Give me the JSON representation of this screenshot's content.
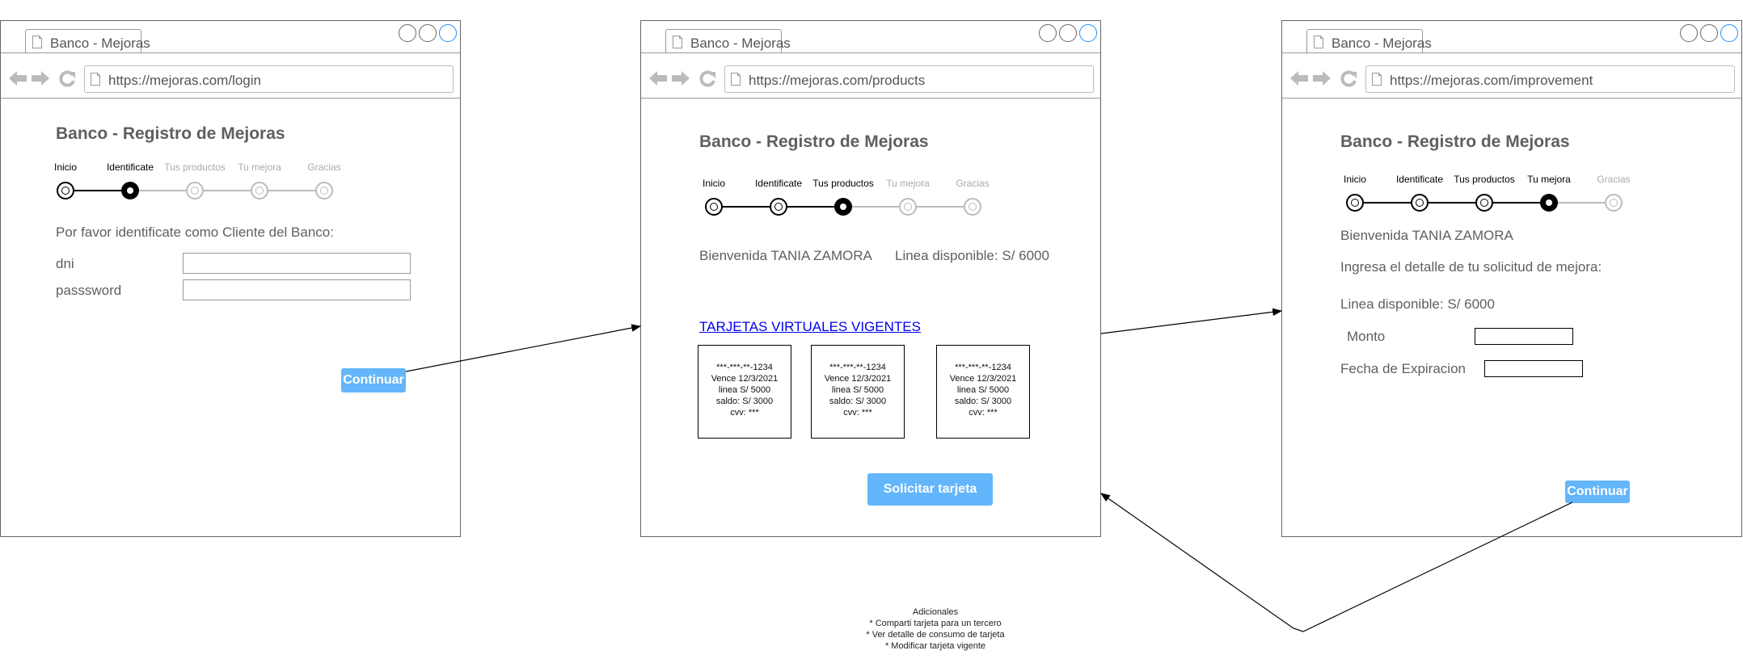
{
  "tab_title": "Banco - Mejoras",
  "heading": "Banco - Registro de Mejoras",
  "steps": [
    "Inicio",
    "Identificate",
    "Tus productos",
    "Tu mejora",
    "Gracias"
  ],
  "screens": {
    "login": {
      "url": "https://mejoras.com/login",
      "prompt": "Por favor identificate como Cliente del Banco:",
      "dni_label": "dni",
      "password_label": "passsword",
      "continue_label": "Continuar"
    },
    "products": {
      "url": "https://mejoras.com/products",
      "welcome": "Bienvenida TANIA ZAMORA",
      "line_available": "Linea disponible: S/ 6000",
      "cards_link": "TARJETAS VIRTUALES VIGENTES",
      "cards": [
        {
          "number": "***-***-**-1234",
          "expiry": "Vence 12/3/2021",
          "line": "linea S/ 5000",
          "balance": "saldo: S/ 3000",
          "cvv": "cvv: ***"
        },
        {
          "number": "***-***-**-1234",
          "expiry": "Vence 12/3/2021",
          "line": "linea S/ 5000",
          "balance": "saldo: S/ 3000",
          "cvv": "cvv: ***"
        },
        {
          "number": "***-***-**-1234",
          "expiry": "Vence 12/3/2021",
          "line": "linea S/ 5000",
          "balance": "saldo: S/ 3000",
          "cvv": "cvv: ***"
        }
      ],
      "request_card_label": "Solicitar tarjeta"
    },
    "improvement": {
      "url": "https://mejoras.com/improvement",
      "welcome": "Bienvenida TANIA ZAMORA",
      "detail_prompt": "Ingresa el detalle de tu solicitud de mejora:",
      "line_available": "Linea disponible: S/ 6000",
      "amount_label": "Monto",
      "expiry_label": "Fecha de Expiracion",
      "continue_label": "Continuar"
    }
  },
  "notes": {
    "title": "Adicionales",
    "items": [
      "* Comparti tarjeta para un tercero",
      "* Ver detalle de consumo de tarjeta",
      "* Modificar tarjeta vigente"
    ]
  },
  "colors": {
    "button": "#63b6fb",
    "link": "#0000ee",
    "step_pending": "#bbbbbb",
    "text": "#5f5f5f"
  },
  "icons": [
    "page-icon",
    "back-arrow-icon",
    "forward-arrow-icon",
    "reload-icon"
  ]
}
